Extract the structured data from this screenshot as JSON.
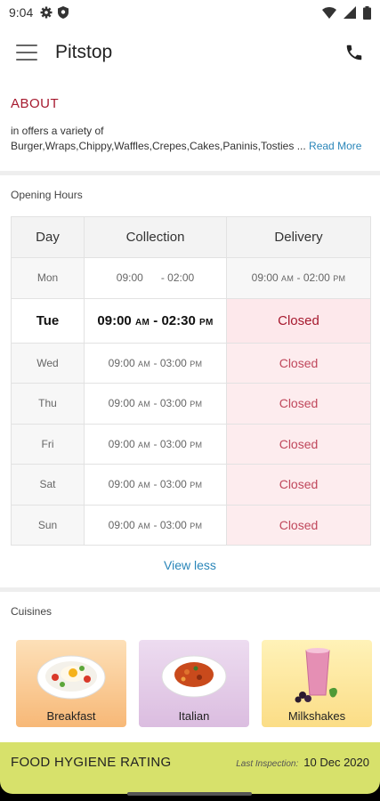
{
  "status_bar": {
    "time": "9:04",
    "left_icons": [
      "gear-icon",
      "shield-icon"
    ],
    "right_icons": [
      "wifi-icon",
      "signal-icon",
      "battery-icon"
    ]
  },
  "app_bar": {
    "title": "Pitstop"
  },
  "about": {
    "heading": "ABOUT",
    "line1": "in offers a variety of",
    "line2": "Burger,Wraps,Chippy,Waffles,Crepes,Cakes,Paninis,Tosties ...",
    "read_more": "Read More"
  },
  "opening_hours": {
    "title": "Opening Hours",
    "headers": [
      "Day",
      "Collection",
      "Delivery"
    ],
    "rows": [
      {
        "day": "Mon",
        "c_open": "09:00",
        "c_open_ampm": "",
        "c_close": "- 02:00",
        "c_close_ampm": "",
        "d_open": "09:00",
        "d_open_ampm": "AM",
        "d_close": "- 02:00",
        "d_close_ampm": "PM",
        "closed": false
      },
      {
        "day": "Tue",
        "c_open": "09:00",
        "c_open_ampm": "AM",
        "c_close": "- 02:30",
        "c_close_ampm": "PM",
        "delivery": "Closed",
        "closed": true,
        "today": true
      },
      {
        "day": "Wed",
        "c_open": "09:00",
        "c_open_ampm": "AM",
        "c_close": "- 03:00",
        "c_close_ampm": "PM",
        "delivery": "Closed",
        "closed": true
      },
      {
        "day": "Thu",
        "c_open": "09:00",
        "c_open_ampm": "AM",
        "c_close": "- 03:00",
        "c_close_ampm": "PM",
        "delivery": "Closed",
        "closed": true
      },
      {
        "day": "Fri",
        "c_open": "09:00",
        "c_open_ampm": "AM",
        "c_close": "- 03:00",
        "c_close_ampm": "PM",
        "delivery": "Closed",
        "closed": true
      },
      {
        "day": "Sat",
        "c_open": "09:00",
        "c_open_ampm": "AM",
        "c_close": "- 03:00",
        "c_close_ampm": "PM",
        "delivery": "Closed",
        "closed": true
      },
      {
        "day": "Sun",
        "c_open": "09:00",
        "c_open_ampm": "AM",
        "c_close": "- 03:00",
        "c_close_ampm": "PM",
        "delivery": "Closed",
        "closed": true
      }
    ],
    "view_less": "View less"
  },
  "cuisines": {
    "title": "Cuisines",
    "items": [
      {
        "label": "Breakfast",
        "icon": "breakfast-plate-icon"
      },
      {
        "label": "Italian",
        "icon": "pasta-plate-icon"
      },
      {
        "label": "Milkshakes",
        "icon": "milkshake-glass-icon"
      }
    ]
  },
  "hygiene": {
    "title": "FOOD HYGIENE RATING",
    "last_inspection_label": "Last Inspection:",
    "last_inspection_date": "10 Dec 2020"
  },
  "colors": {
    "accent_red": "#a6192e",
    "link_blue": "#2a86b9",
    "hygiene_bar": "#d7e16b",
    "closed_bg": "#fdecee"
  }
}
